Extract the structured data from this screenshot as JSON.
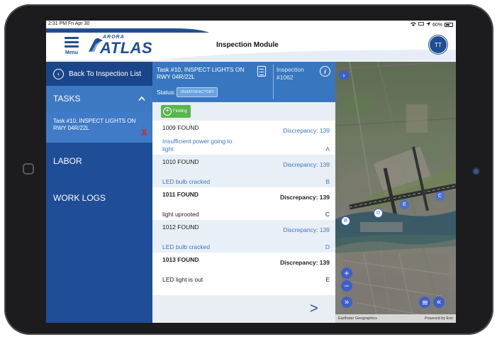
{
  "status_bar": {
    "time": "2:31 PM",
    "date": "Fri Apr 30",
    "battery": "60%"
  },
  "header": {
    "menu_label": "Menu",
    "logo_top": "ARORA",
    "logo_main": "ATLAS",
    "title": "Inspection Module",
    "user_initials": "TT"
  },
  "sidebar": {
    "back_label": "Back To Inspection List",
    "tasks_label": "TASKS",
    "task_item": "Task #10, INSPECT LIGHTS ON RWY 04R/22L",
    "task_remove": "X",
    "items": [
      {
        "label": "LABOR"
      },
      {
        "label": "WORK LOGS"
      }
    ]
  },
  "task_header": {
    "title": "Task #10, INSPECT LIGHTS ON RWY 04R/22L",
    "status_label": "Status:",
    "status_value": "UNSATISFACTORY",
    "inspection_label": "Inspection",
    "inspection_number": "#1062",
    "info_glyph": "i"
  },
  "toolbar": {
    "finding_label": "Finding"
  },
  "findings": [
    {
      "id": "1009 FOUND",
      "discrepancy": "Discrepancy: 139",
      "description": "Insufficient power going to light",
      "marker": "A"
    },
    {
      "id": "1010 FOUND",
      "discrepancy": "Discrepancy: 139",
      "description": "LED bulb cracked",
      "marker": "B"
    },
    {
      "id": "1011 FOUND",
      "discrepancy": "Discrepancy: 139",
      "description": "light uprooted",
      "marker": "C"
    },
    {
      "id": "1012 FOUND",
      "discrepancy": "Discrepancy: 139",
      "description": "LED bulb cracked",
      "marker": "D"
    },
    {
      "id": "1013 FOUND",
      "discrepancy": "Discrepancy: 139",
      "description": "LED light is out",
      "marker": "E"
    }
  ],
  "footer": {
    "next_glyph": ">"
  },
  "map": {
    "markers": [
      "B",
      "D",
      "E",
      "C"
    ],
    "zoom_in": "+",
    "zoom_out": "−",
    "expand_glyph": "»",
    "collapse_glyph": "«",
    "attribution_left": "Earthstar Geographics",
    "attribution_right": "Powered by Esri"
  },
  "colors": {
    "brand_blue": "#1f4e93",
    "sidebar": "#1f4d97",
    "header_blue": "#3877bf",
    "finding_green": "#57b74a",
    "remove_red": "#e02020",
    "marker_blue": "#4a6fd0"
  },
  "icons": [
    "menu-icon",
    "back-chevron-icon",
    "chevron-up-icon",
    "document-icon",
    "info-icon",
    "plus-circle-icon",
    "chevron-right-icon",
    "list-icon"
  ]
}
